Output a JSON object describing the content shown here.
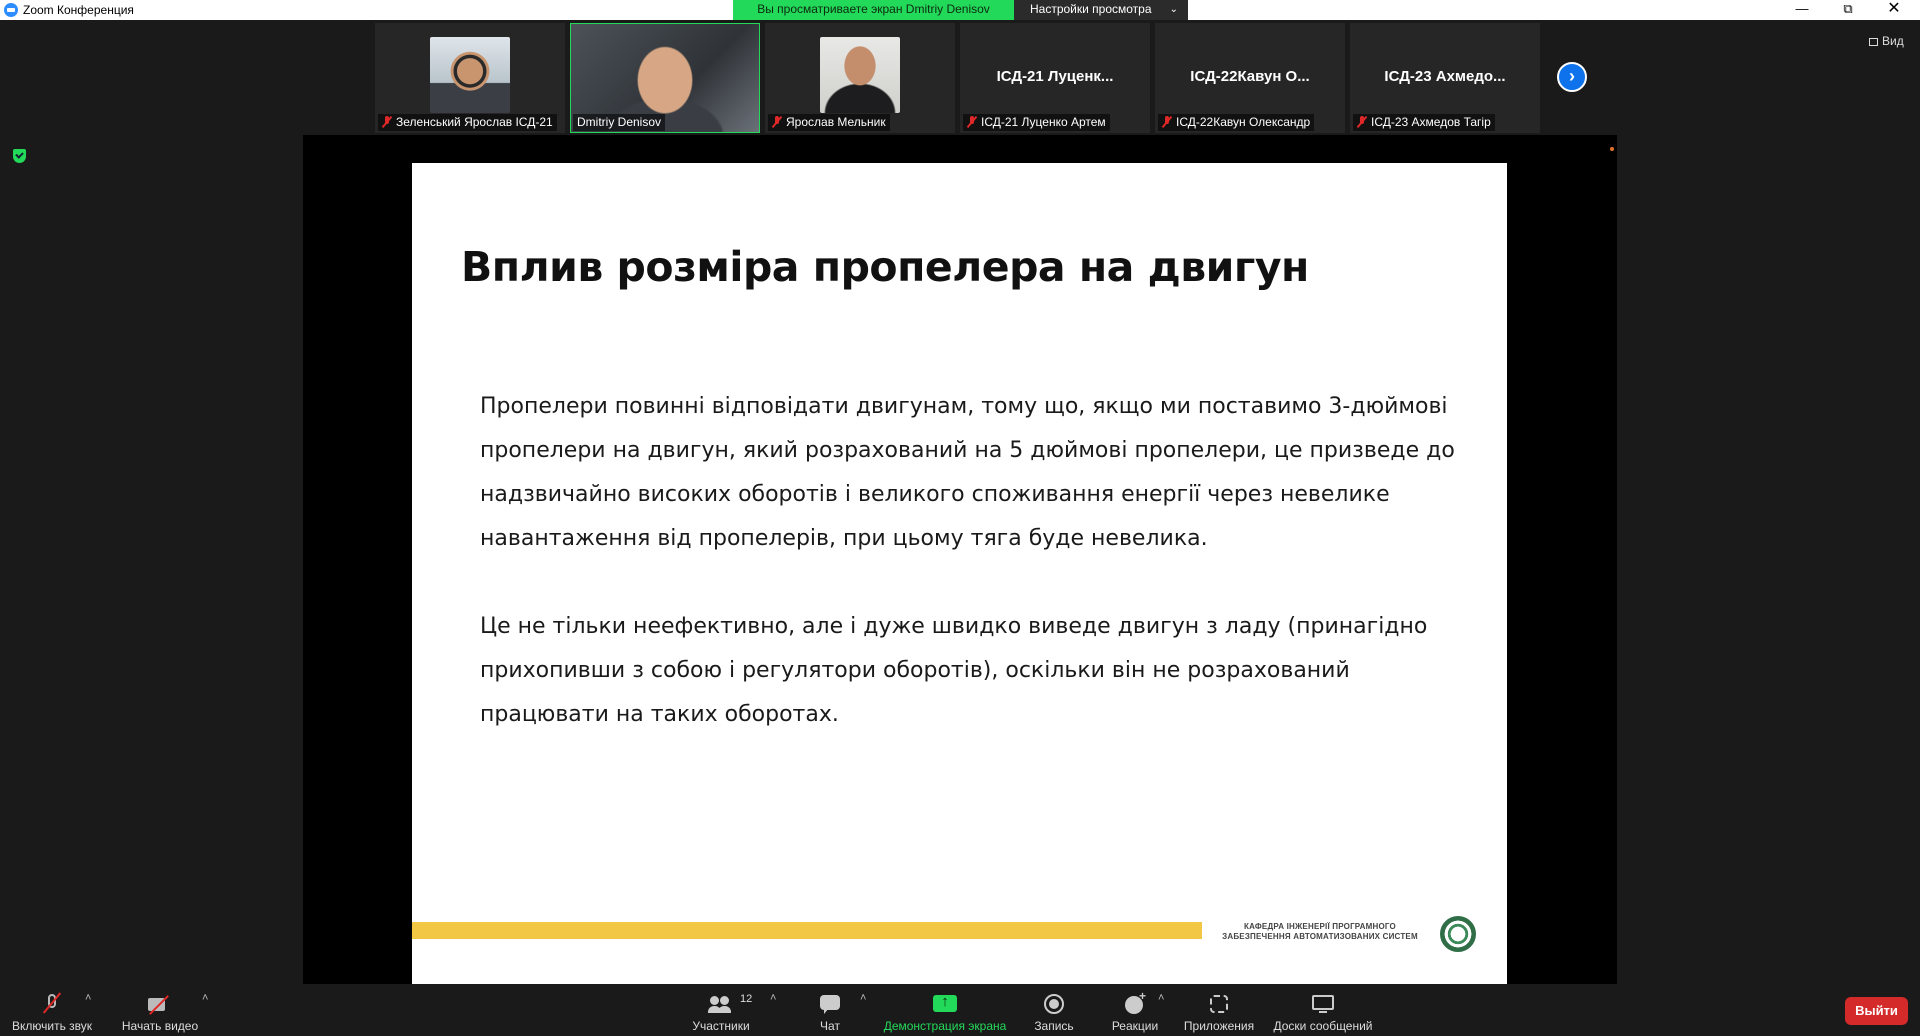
{
  "window": {
    "title": "Zoom Конференция"
  },
  "banner": {
    "share_text": "Вы просматриваете экран Dmitriy Denisov",
    "view_options": "Настройки просмотра"
  },
  "participants": [
    {
      "label": "Зеленський Ярослав ІСД-21",
      "muted": true,
      "video": true
    },
    {
      "label": "Dmitriy Denisov",
      "muted": false,
      "video": true,
      "active_speaker": true
    },
    {
      "label": "Ярослав Мельник",
      "muted": true,
      "video": true
    },
    {
      "label": "ІСД-21 Луценко Артем",
      "display_name": "ІСД-21 Луценк...",
      "muted": true,
      "video": false
    },
    {
      "label": "ІСД-22Кавун Олександр",
      "display_name": "ІСД-22Кавун О...",
      "muted": true,
      "video": false
    },
    {
      "label": "ІСД-23 Ахмедов Тагір",
      "display_name": "ІСД-23 Ахмедо...",
      "muted": true,
      "video": false
    }
  ],
  "view_button": "Вид",
  "slide": {
    "title": "Вплив розміра пропелера на двигун",
    "paragraph1": "Пропелери повинні відповідати двигунам, тому що, якщо ми поставимо 3-дюймові пропелери на двигун, який розрахований на 5 дюймові пропелери, це призведе до надзвичайно високих оборотів і великого споживання енергії через невелике навантаження від пропелерів, при цьому тяга буде невелика.",
    "paragraph2": "Це не тільки неефективно, але і дуже швидко виведе двигун з ладу (принагідно прихопивши з собою і регулятори оборотів), оскільки він не розрахований працювати на таких оборотах.",
    "dept_line1": "КАФЕДРА ІНЖЕНЕРІЇ ПРОГРАМНОГО",
    "dept_line2": "ЗАБЕЗПЕЧЕННЯ АВТОМАТИЗОВАНИХ СИСТЕМ"
  },
  "toolbar": {
    "unmute": "Включить звук",
    "start_video": "Начать видео",
    "participants": "Участники",
    "participants_count": "12",
    "chat": "Чат",
    "share_screen": "Демонстрация экрана",
    "record": "Запись",
    "reactions": "Реакции",
    "apps": "Приложения",
    "whiteboards": "Доски сообщений",
    "leave": "Выйти"
  },
  "colors": {
    "share_green": "#23d959",
    "leave_red": "#d42a2a",
    "accent_blue": "#0e72ed",
    "slide_bar": "#f2c744"
  }
}
